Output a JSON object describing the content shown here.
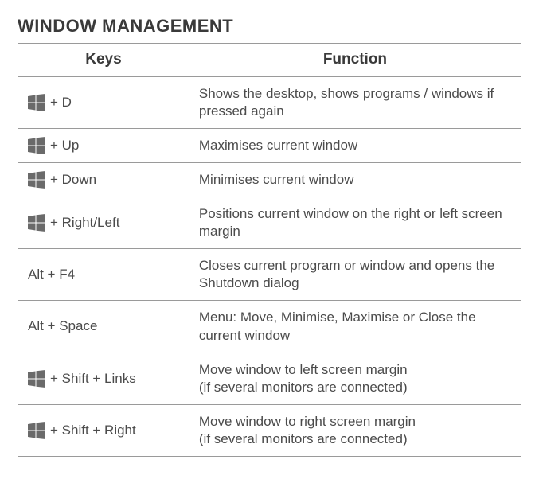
{
  "title": "WINDOW MANAGEMENT",
  "headers": {
    "keys": "Keys",
    "function": "Function"
  },
  "icons": {
    "windows": "windows-key-icon"
  },
  "rows": [
    {
      "hasWinIcon": true,
      "keyText": "+ D",
      "func": "Shows the desktop, shows programs / windows if pressed again"
    },
    {
      "hasWinIcon": true,
      "keyText": "+ Up",
      "func": "Maximises current window"
    },
    {
      "hasWinIcon": true,
      "keyText": "+ Down",
      "func": "Minimises current window"
    },
    {
      "hasWinIcon": true,
      "keyText": "+ Right/Left",
      "func": "Positions current window on the right or left screen margin"
    },
    {
      "hasWinIcon": false,
      "keyText": "Alt + F4",
      "func": "Closes current program or window and opens the Shutdown dialog"
    },
    {
      "hasWinIcon": false,
      "keyText": "Alt + Space",
      "func": "Menu: Move, Minimise, Maximise or Close the current window"
    },
    {
      "hasWinIcon": true,
      "keyText": "+ Shift + Links",
      "func": "Move window to left screen margin\n(if several monitors are connected)"
    },
    {
      "hasWinIcon": true,
      "keyText": "+ Shift + Right",
      "func": "Move window to right screen margin\n(if several monitors are connected)"
    }
  ]
}
